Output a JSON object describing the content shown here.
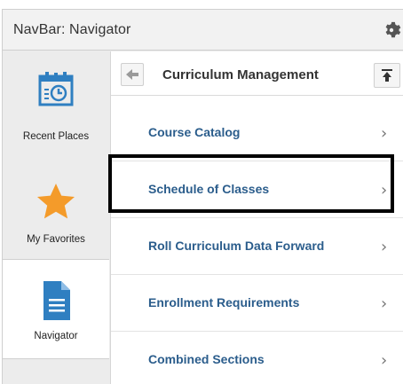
{
  "header": {
    "title": "NavBar: Navigator",
    "settings_icon": "gear-icon"
  },
  "sidebar": {
    "tiles": [
      {
        "label": "Recent Places",
        "icon": "calendar-clock-icon",
        "active": false
      },
      {
        "label": "My Favorites",
        "icon": "star-icon",
        "active": false
      },
      {
        "label": "Navigator",
        "icon": "document-icon",
        "active": true
      }
    ]
  },
  "panel": {
    "title": "Curriculum Management",
    "back_icon": "back-arrow-icon",
    "top_icon": "scroll-to-top-icon",
    "items": [
      {
        "label": "Course Catalog",
        "chevron": "›"
      },
      {
        "label": "Schedule of Classes",
        "chevron": "›",
        "highlighted": true
      },
      {
        "label": "Roll Curriculum Data Forward",
        "chevron": "›"
      },
      {
        "label": "Enrollment Requirements",
        "chevron": "›"
      },
      {
        "label": "Combined Sections",
        "chevron": "›"
      }
    ]
  },
  "colors": {
    "link": "#2b5d8c",
    "accent_blue": "#2f7fc1",
    "star": "#f49b2a",
    "highlight_border": "#000000"
  }
}
